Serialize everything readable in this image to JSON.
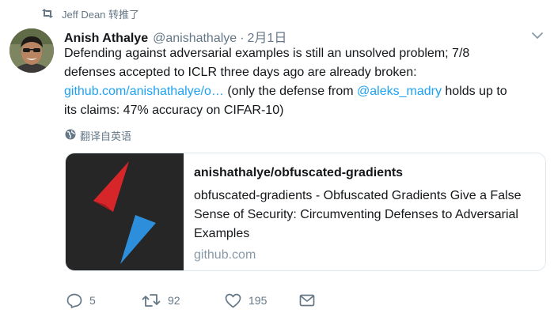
{
  "retweet": {
    "label": "Jeff Dean 转推了"
  },
  "author": {
    "name": "Anish Athalye",
    "handle": "@anishathalye",
    "separator": "·",
    "date": "2月1日"
  },
  "tweet": {
    "line1": "Defending against adversarial examples is still an unsolved problem; 7/8",
    "line2": "defenses accepted to ICLR three days ago are already broken:",
    "link_url": "github.com/anishathalye/o…",
    "text_after_link": " (only the defense from ",
    "mention": "@aleks_madry",
    "text_end_1": " holds up to",
    "line4": "its claims: 47% accuracy on CIFAR-10)"
  },
  "translate": {
    "label": "翻译自英语"
  },
  "card": {
    "title": "anishathalye/obfuscated-gradients",
    "description": "obfuscated-gradients - Obfuscated Gradients Give a False Sense of Security: Circumventing Defenses to Adversarial Examples",
    "domain": "github.com"
  },
  "actions": {
    "replies": "5",
    "retweets": "92",
    "likes": "195"
  },
  "colors": {
    "link": "#1da1f2",
    "muted": "#657786",
    "card_image_bg": "#262626",
    "logo_red": "#d7262a",
    "logo_blue": "#2d8fdc"
  }
}
